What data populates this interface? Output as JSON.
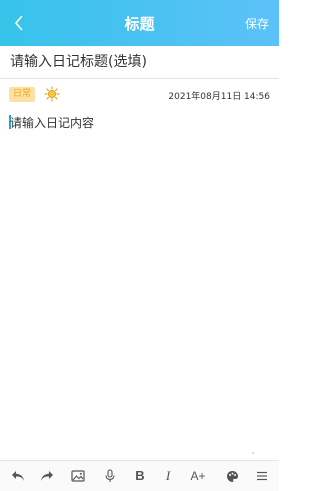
{
  "header": {
    "title": "标题",
    "save_label": "保存",
    "back_icon": "chevron-left-icon"
  },
  "title_field": {
    "placeholder": "请输入日记标题(选填)"
  },
  "meta": {
    "tag_label": "日常",
    "weather_icon": "sun-icon",
    "datetime": "2021年08月11日 14:56"
  },
  "content": {
    "placeholder": "请输入日记内容"
  },
  "toolbar": {
    "bold_label": "B",
    "italic_label": "I",
    "font_size_label": "A+"
  },
  "colors": {
    "header_start": "#36c3ea",
    "header_end": "#5cc1f8",
    "tag_background": "#fbe2a3",
    "tag_text": "#f1a52a",
    "cursor": "#2ca0d8"
  }
}
